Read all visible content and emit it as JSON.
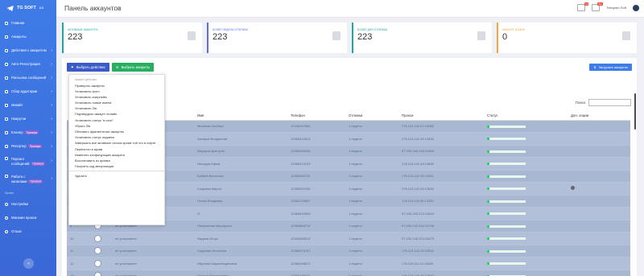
{
  "brand": {
    "name": "TG SOFT",
    "version": "2.0"
  },
  "header": {
    "title": "Панель аккаунтов",
    "notif1_count": "12",
    "notif2_count": "99+",
    "user_label": "Telegram Soft"
  },
  "sidebar": {
    "items": [
      {
        "label": "Главная",
        "chevron": false
      },
      {
        "label": "Аккаунты",
        "chevron": false
      },
      {
        "label": "Действия с аккаунтом",
        "chevron": true
      },
      {
        "label": "Авто-Регистрация",
        "chevron": true
      },
      {
        "label": "Рассылка сообщений",
        "chevron": true
      },
      {
        "label": "Сбор аудитории",
        "chevron": true
      },
      {
        "label": "Инвайт",
        "chevron": true
      },
      {
        "label": "Накрутки",
        "chevron": true
      },
      {
        "label": "Клонер",
        "premium": "Премиум",
        "chevron": true
      },
      {
        "label": "Репортер",
        "premium": "Премиум",
        "chevron": true
      }
    ],
    "two_line": [
      {
        "line1": "Парсинг",
        "line2": "сообщений",
        "premium": "Премиум"
      },
      {
        "line1": "Работа с",
        "line2": "каналами",
        "premium": "Премиум"
      }
    ],
    "section": "Прочее",
    "bottom_items": [
      {
        "label": "Настройки"
      },
      {
        "label": "Магазин прокси"
      },
      {
        "label": "Отзыв"
      }
    ],
    "collapse_icon": "«"
  },
  "stats": [
    {
      "label": "Активные аккаунты",
      "value": "223"
    },
    {
      "label": "Более недели отлежка",
      "value": "223"
    },
    {
      "label": "Более дня отлежка",
      "value": "223"
    },
    {
      "label": "Аккаунт в бане",
      "value": "0"
    }
  ],
  "toolbar": {
    "select_action": "Выбрать действие",
    "select_accounts": "Выбрать аккаунты",
    "export": "Загрузить аккаунты"
  },
  "search": {
    "label": "Поиск:"
  },
  "table": {
    "headers": [
      "",
      "",
      "",
      "Имя",
      "Телефон",
      "Отлежка",
      "Прокси",
      "Статус",
      "Доп. опции"
    ],
    "rows": [
      {
        "n": "",
        "username": "",
        "name": "Миханов Альберт",
        "phone": "12346497660",
        "rest": "1 неделя",
        "proxy": "176.119.140.01:10088",
        "info": false
      },
      {
        "n": "",
        "username": "",
        "name": "Захаров Владислав",
        "phone": "12365412614",
        "rest": "1 неделя",
        "proxy": "176.119.142.43:13838",
        "info": false
      },
      {
        "n": "",
        "username": "",
        "name": "Фёдоров Дмитрий",
        "phone": "12365356405",
        "rest": "1 неделя",
        "proxy": "57.200.240.218:13466",
        "info": false
      },
      {
        "n": "",
        "username": "",
        "name": "Нелидов Ефим",
        "phone": "12365470193",
        "rest": "1 неделя",
        "proxy": "176.119.142.43:13638",
        "info": false
      },
      {
        "n": "",
        "username": "",
        "name": "Бабаев Вячеслав",
        "phone": "12365460732",
        "rest": "1 неделя",
        "proxy": "176.119.142.43:13634",
        "info": false
      },
      {
        "n": "",
        "username": "",
        "name": "Сырьева Мирон",
        "phone": "12365397035",
        "rest": "1 неделя",
        "proxy": "176.119.142.43:13838",
        "info": true
      },
      {
        "n": "",
        "username": "",
        "name": "Носов Владимир",
        "phone": "12363728067",
        "rest": "1 неделя",
        "proxy": "176.119.140.36:13330",
        "info": false
      },
      {
        "n": "8",
        "username": "не установлен",
        "name": "Я",
        "phone": "12365942593",
        "rest": "1 неделя",
        "proxy": "57.200.240.212:13624",
        "info": false
      },
      {
        "n": "9",
        "username": "не установлен",
        "name": "Панфилова Маргарита",
        "phone": "12365868714",
        "rest": "1 неделя",
        "proxy": "57.200.242.216:13798",
        "info": false
      },
      {
        "n": "10",
        "username": "не установлен",
        "name": "Фадеев Игорь",
        "phone": "12365968514",
        "rest": "1 неделя",
        "proxy": "57.200.245.223:13675",
        "info": false
      },
      {
        "n": "11",
        "username": "не установлен",
        "name": "Гордеева Антонина",
        "phone": "12366476187",
        "rest": "1 неделя",
        "proxy": "176.119.142.29:13528",
        "info": false
      },
      {
        "n": "12",
        "username": "не установлен",
        "name": "Ибрагим Шарапетдиновна",
        "phone": "12366498672",
        "rest": "1 неделя",
        "proxy": "176.119.112.11:13849",
        "info": false
      },
      {
        "n": "13",
        "username": "не установлен",
        "name": "Леонид Пантелеевич",
        "phone": "12366446331",
        "rest": "1 неделя",
        "proxy": "176.119.145.48:13648",
        "info": false
      }
    ]
  },
  "dropdown": {
    "header": "Аккаунт действия",
    "items": [
      "Проверить аккаунты",
      "Установить фото",
      "Установить юзернейм",
      "Установить новые имена",
      "Установить 2fa",
      "Подтвердить аккаунт онлайн",
      "Установить статус \"в сети\"",
      "Убрать 2fa",
      "Обновить фрагментные аккаунты",
      "Установить статус недавно",
      "Завершить все активные сессии кроме той что в софте",
      "Перенести в архив",
      "Изменить конфигурацию аккаунта",
      "Восстановить из архива",
      "Получить код авторизации"
    ],
    "delete": "Удалить"
  },
  "colors": {
    "sidebar": "#3f7ce8",
    "accent_teal": "#19a7a8",
    "accent_blue": "#5a6ee0",
    "accent_orange": "#f2a83b",
    "btn_green": "#27ae60",
    "status_green": "#2ecc71"
  }
}
